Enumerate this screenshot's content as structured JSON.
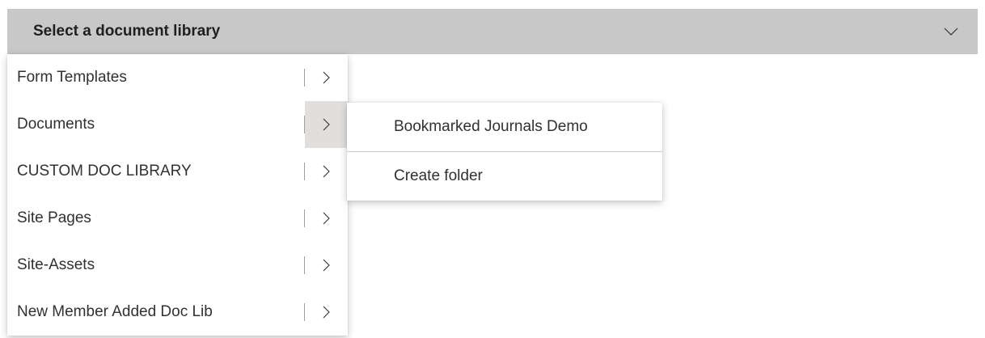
{
  "dropdown": {
    "title": "Select a document library",
    "chevron_icon": "chevron-down-icon"
  },
  "menu": {
    "items": [
      {
        "label": "Form Templates",
        "submenu_icon": "chevron-right-icon",
        "active": false
      },
      {
        "label": "Documents",
        "submenu_icon": "chevron-right-icon",
        "active": true
      },
      {
        "label": "CUSTOM DOC LIBRARY",
        "submenu_icon": "chevron-right-icon",
        "active": false
      },
      {
        "label": "Site Pages",
        "submenu_icon": "chevron-right-icon",
        "active": false
      },
      {
        "label": "Site-Assets",
        "submenu_icon": "chevron-right-icon",
        "active": false
      },
      {
        "label": "New Member Added Doc Lib",
        "submenu_icon": "chevron-right-icon",
        "active": false
      }
    ]
  },
  "submenu": {
    "items": [
      {
        "label": "Bookmarked Journals Demo"
      },
      {
        "label": "Create folder"
      }
    ]
  },
  "colors": {
    "header_bg": "#c8c8c8",
    "active_trigger_bg": "#e1dfdd",
    "text": "#323130"
  }
}
